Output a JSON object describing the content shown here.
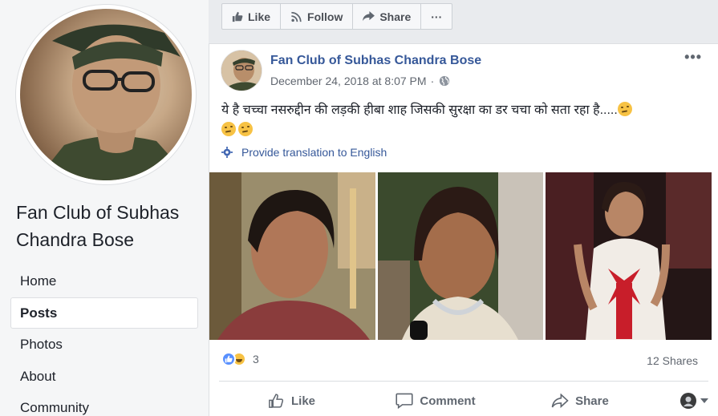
{
  "page": {
    "name": "Fan Club of Subhas Chandra Bose"
  },
  "nav": [
    {
      "label": "Home"
    },
    {
      "label": "Posts",
      "active": true
    },
    {
      "label": "Photos"
    },
    {
      "label": "About"
    },
    {
      "label": "Community"
    }
  ],
  "actionbar": {
    "like": "Like",
    "follow": "Follow",
    "share": "Share",
    "more": "···"
  },
  "post": {
    "author": "Fan Club of Subhas Chandra Bose",
    "timestamp": "December 24, 2018 at 8:07 PM",
    "separator": "·",
    "text": "ये है चच्चा नसरुद्दीन की लड़की हीबा शाह जिसकी सुरक्षा का डर चचा को सता रहा है.....",
    "translate": "Provide translation to English",
    "more": "•••",
    "reaction_count": "3",
    "shares": "12 Shares",
    "actions": {
      "like": "Like",
      "comment": "Comment",
      "share": "Share"
    }
  },
  "colors": {
    "link": "#365899",
    "like_blue": "#5890ff",
    "bg": "#e9ebee"
  }
}
